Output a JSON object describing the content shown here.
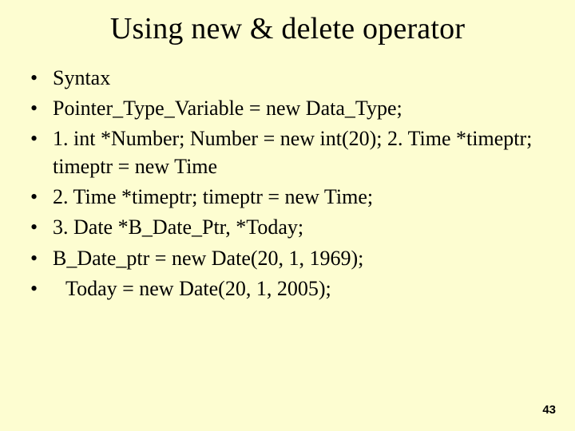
{
  "title": "Using new & delete operator",
  "bullets": [
    "Syntax",
    "Pointer_Type_Variable = new Data_Type;",
    "1. int *Number;  Number = new int(20); 2. Time *timeptr; timeptr = new Time",
    "2. Time *timeptr; timeptr = new Time;",
    "3. Date *B_Date_Ptr, *Today;",
    "B_Date_ptr = new Date(20, 1, 1969);",
    "  Today = new Date(20, 1, 2005);"
  ],
  "pageNumber": "43"
}
